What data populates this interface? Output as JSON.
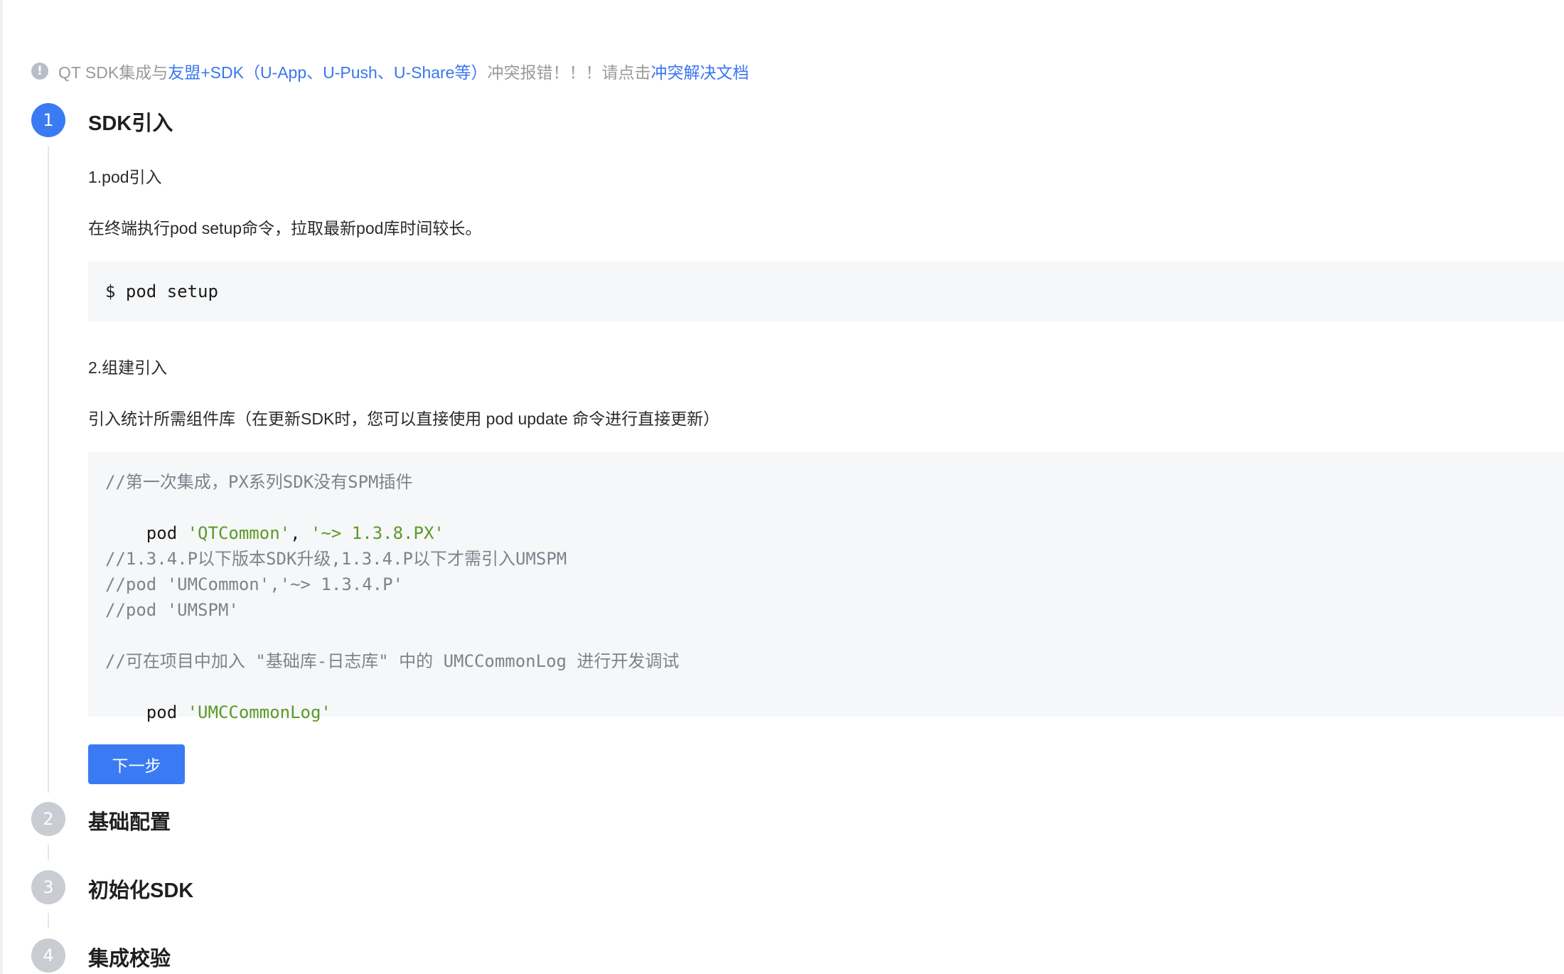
{
  "notice": {
    "prefix": "QT SDK集成与",
    "link1": "友盟+SDK（U-App、U-Push、U-Share等）",
    "middle": "冲突报错！！！请点击",
    "link2": "冲突解决文档",
    "icon": "exclamation-icon"
  },
  "steps": [
    {
      "num": "1",
      "title": "SDK引入",
      "state": "active"
    },
    {
      "num": "2",
      "title": "基础配置",
      "state": "inactive"
    },
    {
      "num": "3",
      "title": "初始化SDK",
      "state": "inactive"
    },
    {
      "num": "4",
      "title": "集成校验",
      "state": "inactive"
    }
  ],
  "step1": {
    "sub1": "1.pod引入",
    "desc1": "在终端执行pod setup命令，拉取最新pod库时间较长。",
    "code1": "$ pod setup",
    "sub2": "2.组建引入",
    "desc2": "引入统计所需组件库（在更新SDK时，您可以直接使用 pod update 命令进行直接更新）",
    "code2": {
      "line1": "//第一次集成，PX系列SDK没有SPM插件",
      "line2_kw": "pod ",
      "line2_str1": "'QTCommon'",
      "line2_sep": ", ",
      "line2_str2": "'~> 1.3.8.PX'",
      "line3": "//1.3.4.P以下版本SDK升级,1.3.4.P以下才需引入UMSPM",
      "line4": "//pod 'UMCommon','~> 1.3.4.P'",
      "line5": "//pod 'UMSPM'",
      "line6": "//可在项目中加入 \"基础库-日志库\" 中的 UMCCommonLog 进行开发调试",
      "line7_kw": "pod ",
      "line7_str": "'UMCCommonLog'"
    },
    "next_label": "下一步"
  },
  "colors": {
    "accent": "#3a7bf4",
    "link": "#3a76f0",
    "inactive_step": "#c9ccd2",
    "code_bg": "#f6f7f9",
    "code_string": "#5b9a25",
    "code_comment": "#7d838c"
  }
}
